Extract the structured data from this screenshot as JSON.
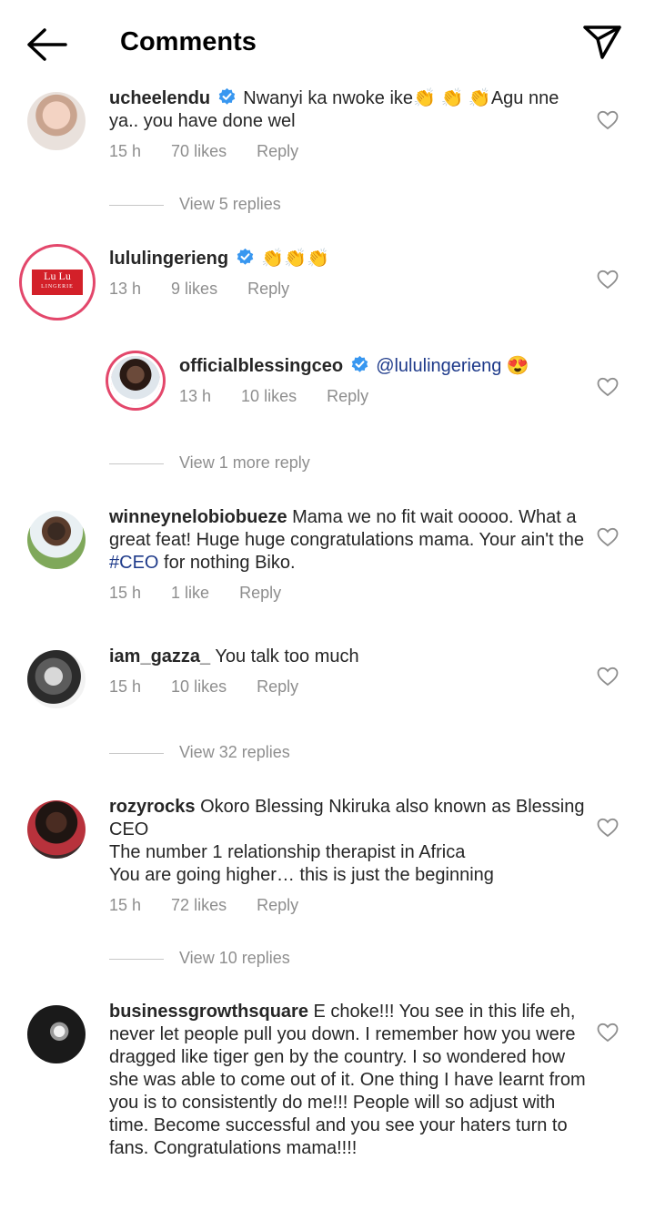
{
  "header": {
    "title": "Comments"
  },
  "comments": [
    {
      "user": "ucheelendu",
      "verified": true,
      "text": "Nwanyi ka nwoke ike👏 👏 👏Agu nne ya.. you have done wel",
      "time": "15 h",
      "likes": "70 likes",
      "reply": "Reply",
      "view": "View 5 replies"
    },
    {
      "user": "lululingerieng",
      "verified": true,
      "text": "👏👏👏",
      "time": "13 h",
      "likes": "9 likes",
      "reply": "Reply",
      "logo_line1": "Lu Lu",
      "logo_line2": "LINGERIE"
    },
    {
      "user": "officialblessingceo",
      "verified": true,
      "mention": "@lululingerieng",
      "text": "😍",
      "time": "13 h",
      "likes": "10 likes",
      "reply": "Reply",
      "view": "View 1 more reply"
    },
    {
      "user": "winneynelobiobueze",
      "text_before": "Mama we no fit wait ooooo. What a great feat! Huge huge congratulations mama. Your ain't the ",
      "hashtag": "#CEO",
      "text_after": " for nothing Biko.",
      "time": "15 h",
      "likes": "1 like",
      "reply": "Reply"
    },
    {
      "user": "iam_gazza_",
      "text": "You talk too much",
      "time": "15 h",
      "likes": "10 likes",
      "reply": "Reply",
      "view": "View 32 replies"
    },
    {
      "user": "rozyrocks",
      "text": "Okoro Blessing Nkiruka also known as Blessing CEO",
      "text_line2": "The number 1 relationship therapist in Africa",
      "text_line3": "You are going higher… this is just the beginning",
      "time": "15 h",
      "likes": "72 likes",
      "reply": "Reply",
      "view": "View 10 replies"
    },
    {
      "user": "businessgrowthsquare",
      "text": "E choke!!! You see in this life eh, never let people pull you down. I remember how you were dragged like tiger gen by the country. I so wondered how she was able to come out of it. One thing I have learnt from you is to consistently do me!!! People will so adjust with time. Become successful and you see your haters turn to fans. Congratulations mama!!!!"
    }
  ],
  "icons": {
    "back": "back-arrow-icon",
    "send": "send-icon",
    "heart": "heart-outline-icon",
    "verified": "verified-badge-icon"
  },
  "colors": {
    "verified": "#3897f0",
    "mention": "#1e3a8a",
    "ring": "#e3476b",
    "meta": "#8e8e8e"
  }
}
